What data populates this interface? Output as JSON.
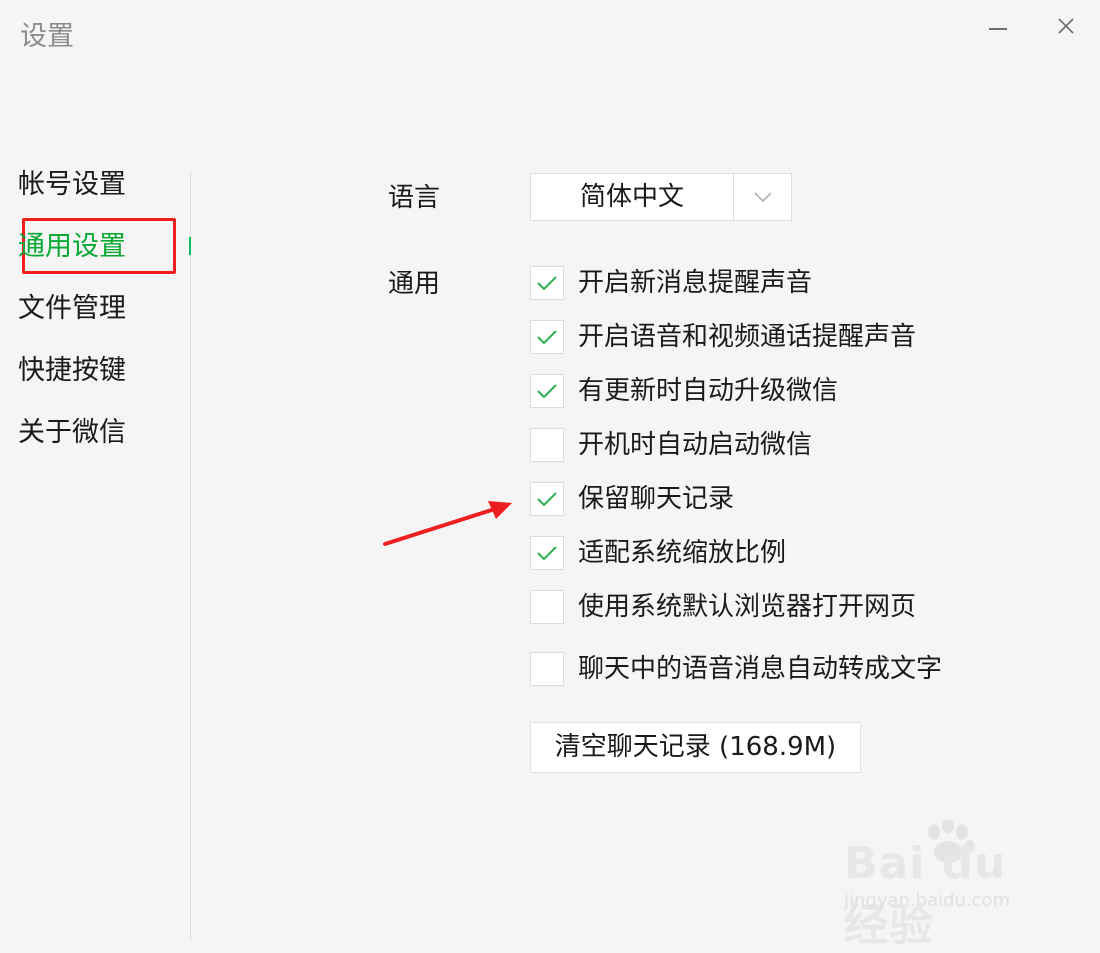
{
  "window": {
    "title": "设置",
    "minimize_icon": "minimize-icon",
    "close_icon": "close-icon"
  },
  "sidebar": {
    "items": [
      {
        "label": "帐号设置",
        "active": false
      },
      {
        "label": "通用设置",
        "active": true
      },
      {
        "label": "文件管理",
        "active": false
      },
      {
        "label": "快捷按键",
        "active": false
      },
      {
        "label": "关于微信",
        "active": false
      }
    ]
  },
  "settings": {
    "language_label": "语言",
    "language_value": "简体中文",
    "general_label": "通用",
    "options": [
      {
        "label": "开启新消息提醒声音",
        "checked": true
      },
      {
        "label": "开启语音和视频通话提醒声音",
        "checked": true
      },
      {
        "label": "有更新时自动升级微信",
        "checked": true
      },
      {
        "label": "开机时自动启动微信",
        "checked": false
      },
      {
        "label": "保留聊天记录",
        "checked": true
      },
      {
        "label": "适配系统缩放比例",
        "checked": true
      },
      {
        "label": "使用系统默认浏览器打开网页",
        "checked": false
      },
      {
        "label": "聊天中的语音消息自动转成文字",
        "checked": false
      }
    ],
    "clear_history_button": "清空聊天记录 (168.9M)"
  },
  "watermark": {
    "logo_text": "Bai du 经验",
    "url": "jingyan.baidu.com"
  },
  "colors": {
    "accent_green": "#07c160",
    "annotation_red": "#f01f1f",
    "background": "#f5f5f5"
  }
}
